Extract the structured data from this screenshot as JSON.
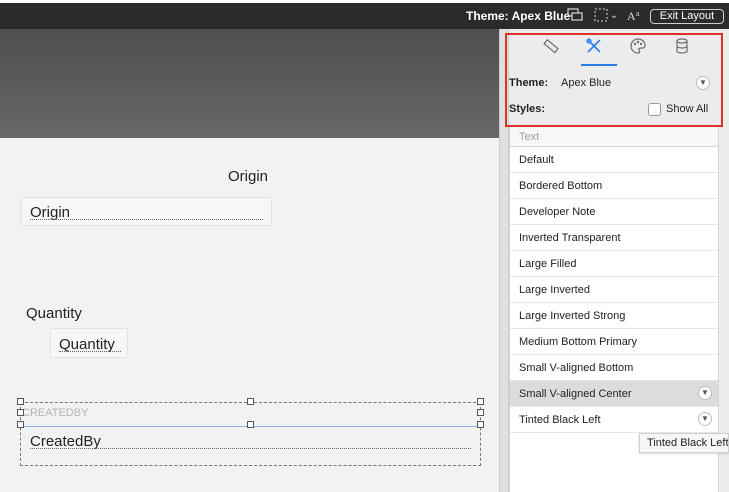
{
  "topbar": {
    "theme_label": "Theme: Apex Blue",
    "exit_label": "Exit Layout",
    "icons": [
      "layout-theme-icon",
      "select-object-icon",
      "chevron-down-icon",
      "text-format-icon"
    ]
  },
  "canvas": {
    "origin_label": "Origin",
    "origin_field": "Origin",
    "quantity_label": "Quantity",
    "quantity_field": "Quantity",
    "createdby_label": "CREATEDBY",
    "createdby_field": "CreatedBy"
  },
  "inspector": {
    "tabs": [
      "position-ruler-icon",
      "styles-tools-icon",
      "appearance-palette-icon",
      "data-database-icon"
    ],
    "active_tab": 1,
    "theme_label": "Theme:",
    "theme_value": "Apex Blue",
    "styles_label": "Styles:",
    "show_all_label": "Show All",
    "list_header": "Text",
    "styles": [
      "Default",
      "Bordered Bottom",
      "Developer Note",
      "Inverted Transparent",
      "Large Filled",
      "Large Inverted",
      "Large Inverted Strong",
      "Medium Bottom Primary",
      "Small V-aligned Bottom",
      "Small V-aligned Center",
      "Tinted Black Left"
    ],
    "selected_style": "Small V-aligned Center",
    "tooltip": "Tinted Black Left"
  },
  "colors": {
    "accent": "#2b7de9",
    "highlight_frame": "#e0302a",
    "topbar": "#2b2b2b"
  }
}
